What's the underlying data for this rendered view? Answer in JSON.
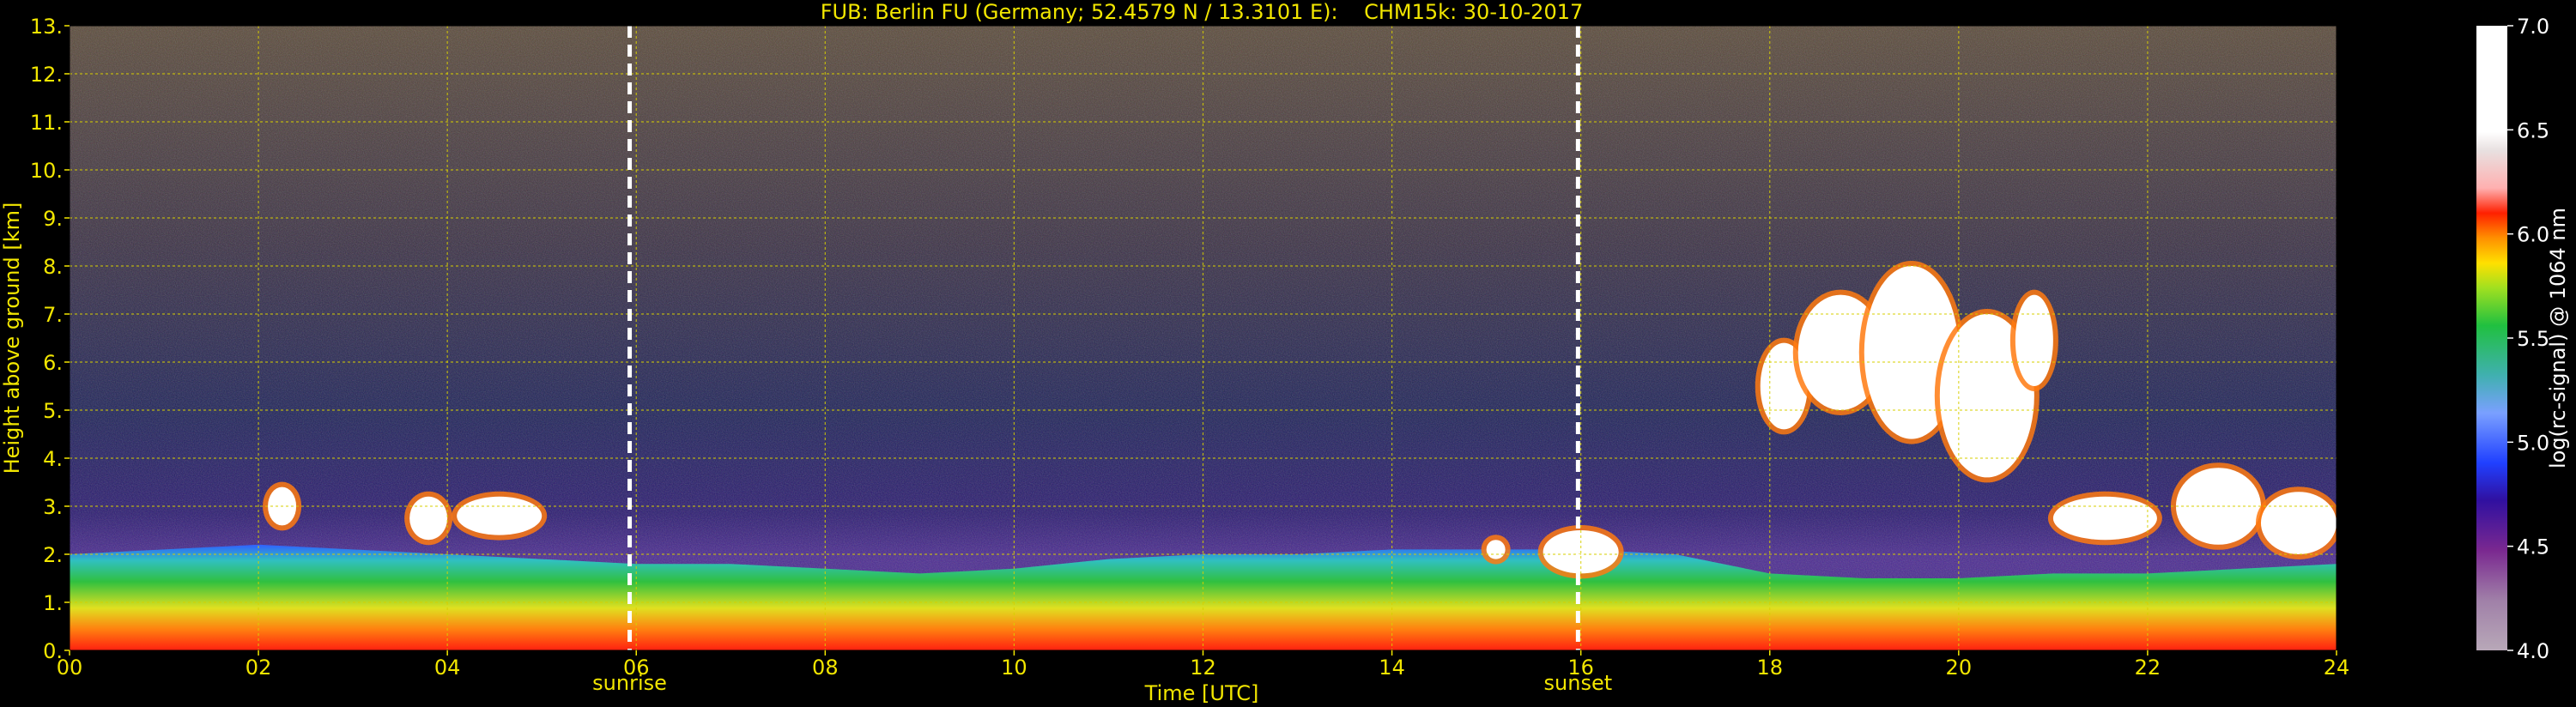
{
  "chart_data": {
    "type": "heatmap",
    "title": "FUB: Berlin FU (Germany; 52.4579 N / 13.3101 E):    CHM15k: 30-10-2017",
    "xlabel": "Time [UTC]",
    "ylabel": "Height above ground [km]",
    "xlim": [
      0,
      24
    ],
    "ylim": [
      0,
      13
    ],
    "x_ticks": [
      "00",
      "02",
      "04",
      "06",
      "08",
      "10",
      "12",
      "14",
      "16",
      "18",
      "20",
      "22",
      "24"
    ],
    "y_ticks": [
      "0.",
      "1.",
      "2.",
      "3.",
      "4.",
      "5.",
      "6.",
      "7.",
      "8.",
      "9.",
      "10.",
      "11.",
      "12.",
      "13."
    ],
    "grid": true,
    "markers": [
      {
        "label": "sunrise",
        "time": 5.93
      },
      {
        "label": "sunset",
        "time": 15.97
      }
    ],
    "colorbar": {
      "label": "log(rc-signal) @ 1064 nm",
      "range": [
        4.0,
        7.0
      ],
      "ticks": [
        "4.0",
        "4.5",
        "5.0",
        "5.5",
        "6.0",
        "6.5",
        "7.0"
      ]
    },
    "boundary_layer": {
      "times": [
        0,
        1,
        2,
        3,
        4,
        5,
        6,
        7,
        8,
        9,
        10,
        11,
        12,
        13,
        14,
        15,
        16,
        17,
        18,
        19,
        20,
        21,
        22,
        23,
        24
      ],
      "heights": [
        2.0,
        2.1,
        2.2,
        2.1,
        2.0,
        1.9,
        1.8,
        1.8,
        1.7,
        1.6,
        1.7,
        1.9,
        2.0,
        2.0,
        2.1,
        2.1,
        2.1,
        2.0,
        1.6,
        1.5,
        1.5,
        1.6,
        1.6,
        1.7,
        1.8
      ]
    },
    "clouds": [
      {
        "t0": 2.1,
        "t1": 2.4,
        "h0": 2.6,
        "h1": 3.4
      },
      {
        "t0": 3.6,
        "t1": 4.0,
        "h0": 2.3,
        "h1": 3.2
      },
      {
        "t0": 4.1,
        "t1": 5.0,
        "h0": 2.4,
        "h1": 3.2
      },
      {
        "t0": 15.0,
        "t1": 15.2,
        "h0": 1.9,
        "h1": 2.3
      },
      {
        "t0": 15.6,
        "t1": 16.4,
        "h0": 1.6,
        "h1": 2.5
      },
      {
        "t0": 17.9,
        "t1": 18.4,
        "h0": 4.6,
        "h1": 6.4
      },
      {
        "t0": 18.3,
        "t1": 19.2,
        "h0": 5.0,
        "h1": 7.4
      },
      {
        "t0": 19.0,
        "t1": 20.0,
        "h0": 4.4,
        "h1": 8.0
      },
      {
        "t0": 19.8,
        "t1": 20.8,
        "h0": 3.6,
        "h1": 7.0
      },
      {
        "t0": 20.6,
        "t1": 21.0,
        "h0": 5.5,
        "h1": 7.4
      },
      {
        "t0": 21.0,
        "t1": 22.1,
        "h0": 2.3,
        "h1": 3.2
      },
      {
        "t0": 22.3,
        "t1": 23.2,
        "h0": 2.2,
        "h1": 3.8
      },
      {
        "t0": 23.2,
        "t1": 24.0,
        "h0": 2.0,
        "h1": 3.3
      }
    ]
  }
}
